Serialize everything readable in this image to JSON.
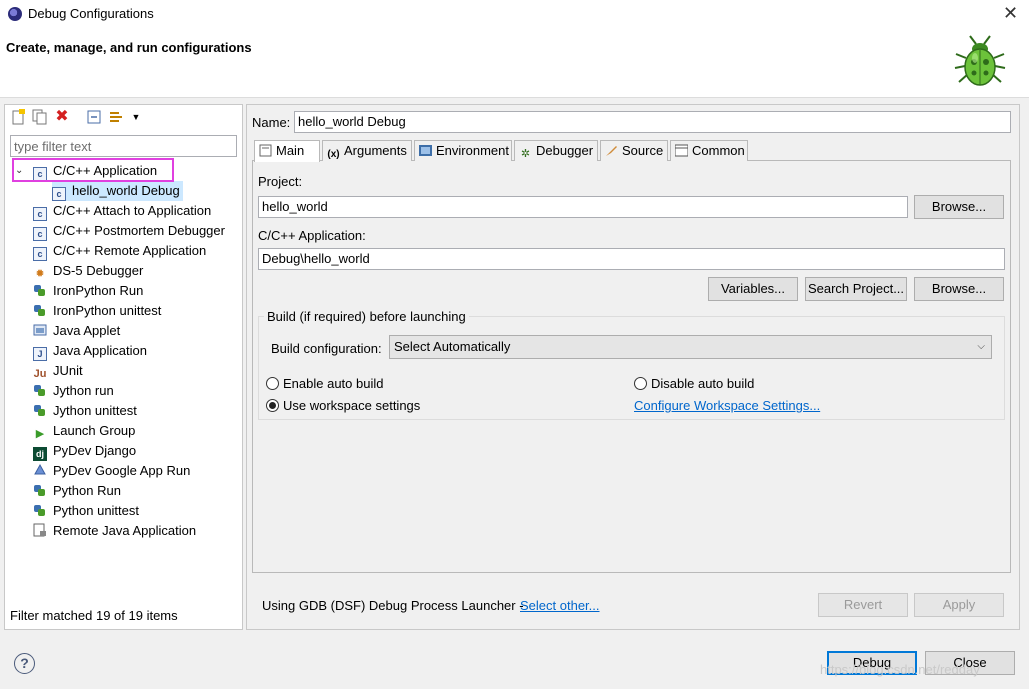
{
  "window": {
    "title": "Debug Configurations",
    "subtitle": "Create, manage, and run configurations",
    "close_glyph": "✕"
  },
  "left": {
    "filter_placeholder": "type filter text",
    "tree": [
      {
        "label": "C/C++ Application",
        "icon": "c-app-icon",
        "expanded": true
      },
      {
        "label": "hello_world Debug",
        "icon": "c-app-icon",
        "selected": true
      },
      {
        "label": "C/C++ Attach to Application",
        "icon": "c-app-icon"
      },
      {
        "label": "C/C++ Postmortem Debugger",
        "icon": "c-app-icon"
      },
      {
        "label": "C/C++ Remote Application",
        "icon": "c-app-icon"
      },
      {
        "label": "DS-5 Debugger",
        "icon": "gear-icon"
      },
      {
        "label": "IronPython Run",
        "icon": "python-icon"
      },
      {
        "label": "IronPython unittest",
        "icon": "python-icon"
      },
      {
        "label": "Java Applet",
        "icon": "applet-icon"
      },
      {
        "label": "Java Application",
        "icon": "java-icon"
      },
      {
        "label": "JUnit",
        "icon": "junit-icon"
      },
      {
        "label": "Jython run",
        "icon": "python-icon"
      },
      {
        "label": "Jython unittest",
        "icon": "python-icon"
      },
      {
        "label": "Launch Group",
        "icon": "launch-group-icon"
      },
      {
        "label": "PyDev Django",
        "icon": "django-icon"
      },
      {
        "label": "PyDev Google App Run",
        "icon": "google-app-icon"
      },
      {
        "label": "Python Run",
        "icon": "python-icon"
      },
      {
        "label": "Python unittest",
        "icon": "python-icon"
      },
      {
        "label": "Remote Java Application",
        "icon": "remote-java-icon"
      }
    ],
    "filter_status": "Filter matched 19 of 19 items"
  },
  "right": {
    "name_label": "Name:",
    "name_value": "hello_world Debug",
    "tabs": [
      "Main",
      "Arguments",
      "Environment",
      "Debugger",
      "Source",
      "Common"
    ],
    "project_label": "Project:",
    "project_value": "hello_world",
    "browse_label": "Browse...",
    "app_label": "C/C++ Application:",
    "app_value": "Debug\\hello_world",
    "variables_label": "Variables...",
    "search_project_label": "Search Project...",
    "group_title": "Build (if required) before launching",
    "build_config_label": "Build configuration:",
    "build_config_value": "Select Automatically",
    "enable_auto_build": "Enable auto build",
    "disable_auto_build": "Disable auto build",
    "use_workspace": "Use workspace settings",
    "configure_workspace": "Configure Workspace Settings...",
    "launcher_text": "Using GDB (DSF) Debug Process Launcher -",
    "select_other": "Select other...",
    "revert_label": "Revert",
    "apply_label": "Apply"
  },
  "footer": {
    "debug_label": "Debug",
    "close_label": "Close",
    "help_glyph": "?",
    "watermark": "https://blog.csdn.net/redday"
  }
}
